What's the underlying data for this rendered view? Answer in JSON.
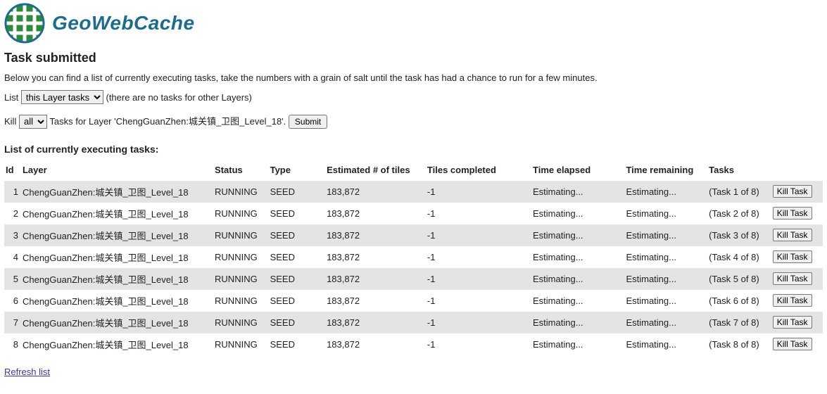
{
  "brand": "GeoWebCache",
  "title": "Task submitted",
  "intro": "Below you can find a list of currently executing tasks, take the numbers with a grain of salt until the task has had a chance to run for a few minutes.",
  "list_filter": {
    "label_prefix": "List",
    "selected": "this Layer tasks",
    "options": [
      "this Layer tasks"
    ],
    "note": "(there are no tasks for other Layers)"
  },
  "kill_form": {
    "label_prefix": "Kill",
    "selected": "all",
    "options": [
      "all"
    ],
    "label_suffix": "Tasks for Layer 'ChengGuanZhen:城关镇_卫图_Level_18'.",
    "submit_label": "Submit"
  },
  "section_heading": "List of currently executing tasks:",
  "columns": {
    "id": "Id",
    "layer": "Layer",
    "status": "Status",
    "type": "Type",
    "est": "Estimated # of tiles",
    "completed": "Tiles completed",
    "elapsed": "Time elapsed",
    "remaining": "Time remaining",
    "tasks": "Tasks"
  },
  "kill_button_label": "Kill Task",
  "rows": [
    {
      "id": "1",
      "layer": "ChengGuanZhen:城关镇_卫图_Level_18",
      "status": "RUNNING",
      "type": "SEED",
      "est": "183,872",
      "completed": "-1",
      "elapsed": "Estimating...",
      "remaining": "Estimating...",
      "tasks": "(Task 1 of 8)"
    },
    {
      "id": "2",
      "layer": "ChengGuanZhen:城关镇_卫图_Level_18",
      "status": "RUNNING",
      "type": "SEED",
      "est": "183,872",
      "completed": "-1",
      "elapsed": "Estimating...",
      "remaining": "Estimating...",
      "tasks": "(Task 2 of 8)"
    },
    {
      "id": "3",
      "layer": "ChengGuanZhen:城关镇_卫图_Level_18",
      "status": "RUNNING",
      "type": "SEED",
      "est": "183,872",
      "completed": "-1",
      "elapsed": "Estimating...",
      "remaining": "Estimating...",
      "tasks": "(Task 3 of 8)"
    },
    {
      "id": "4",
      "layer": "ChengGuanZhen:城关镇_卫图_Level_18",
      "status": "RUNNING",
      "type": "SEED",
      "est": "183,872",
      "completed": "-1",
      "elapsed": "Estimating...",
      "remaining": "Estimating...",
      "tasks": "(Task 4 of 8)"
    },
    {
      "id": "5",
      "layer": "ChengGuanZhen:城关镇_卫图_Level_18",
      "status": "RUNNING",
      "type": "SEED",
      "est": "183,872",
      "completed": "-1",
      "elapsed": "Estimating...",
      "remaining": "Estimating...",
      "tasks": "(Task 5 of 8)"
    },
    {
      "id": "6",
      "layer": "ChengGuanZhen:城关镇_卫图_Level_18",
      "status": "RUNNING",
      "type": "SEED",
      "est": "183,872",
      "completed": "-1",
      "elapsed": "Estimating...",
      "remaining": "Estimating...",
      "tasks": "(Task 6 of 8)"
    },
    {
      "id": "7",
      "layer": "ChengGuanZhen:城关镇_卫图_Level_18",
      "status": "RUNNING",
      "type": "SEED",
      "est": "183,872",
      "completed": "-1",
      "elapsed": "Estimating...",
      "remaining": "Estimating...",
      "tasks": "(Task 7 of 8)"
    },
    {
      "id": "8",
      "layer": "ChengGuanZhen:城关镇_卫图_Level_18",
      "status": "RUNNING",
      "type": "SEED",
      "est": "183,872",
      "completed": "-1",
      "elapsed": "Estimating...",
      "remaining": "Estimating...",
      "tasks": "(Task 8 of 8)"
    }
  ],
  "refresh_label": "Refresh list"
}
